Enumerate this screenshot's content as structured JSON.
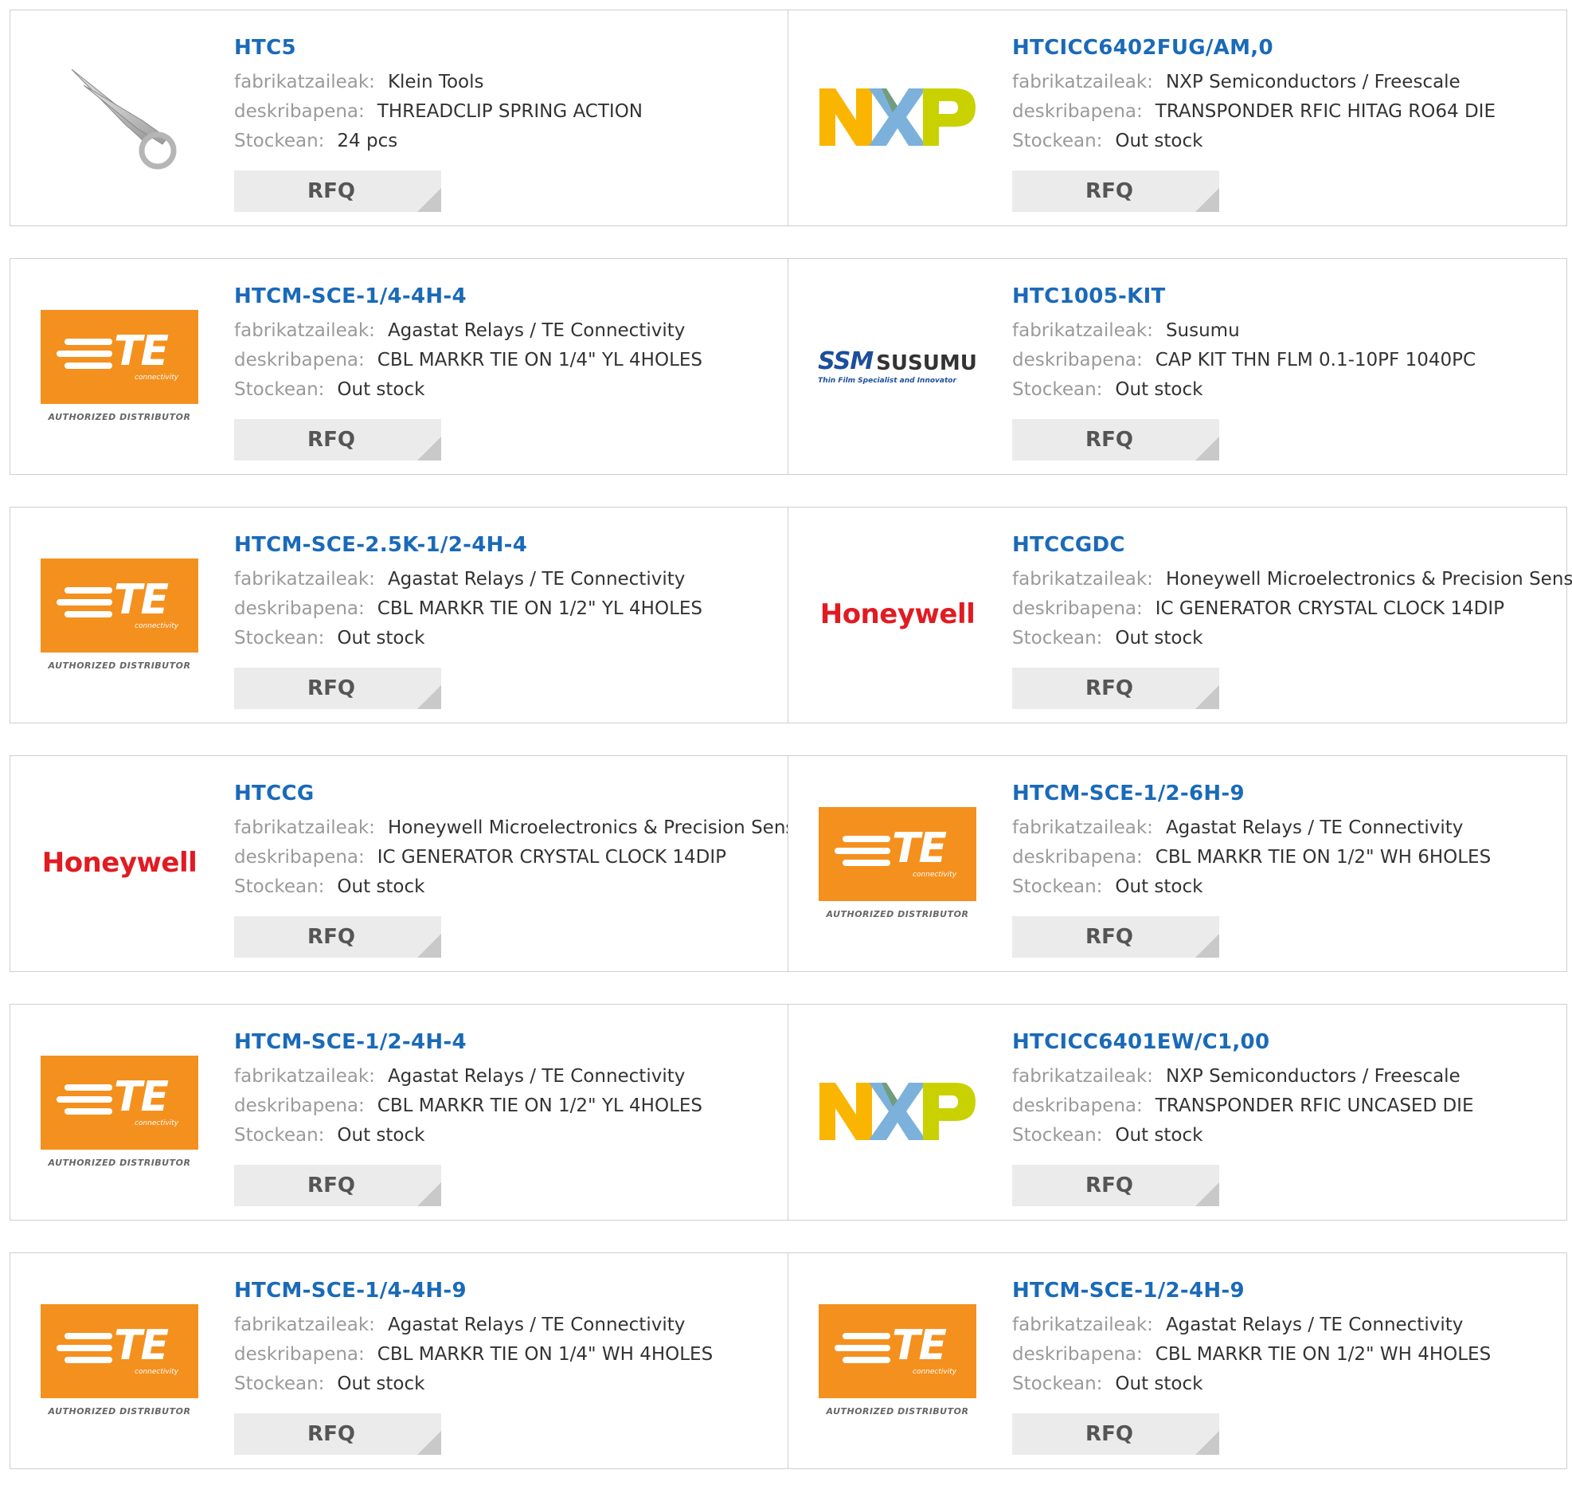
{
  "labels": {
    "manufacturer": "fabrikatzaileak:",
    "description": "deskribapena:",
    "stock": "Stockean:",
    "rfq": "RFQ"
  },
  "logo_texts": {
    "te_authorized": "AUTHORIZED DISTRIBUTOR",
    "te_sub": "connectivity",
    "te_letters": "TE",
    "honeywell": "Honeywell",
    "susumu_mark": "SSM",
    "susumu_name": "SUSUMU",
    "susumu_tag": "Thin Film Specialist and Innovator",
    "nxp": "NXP"
  },
  "colors": {
    "part_link": "#1a6ab8",
    "te_orange": "#f4901e",
    "honeywell_red": "#e11b22",
    "nxp_yellow": "#f9b500",
    "nxp_blue": "#7bb1db",
    "nxp_green": "#c9d200"
  },
  "products": [
    {
      "part": "HTC5",
      "logo": "scissors-image",
      "manufacturer": "Klein Tools",
      "description": "THREADCLIP SPRING ACTION",
      "stock": "24 pcs"
    },
    {
      "part": "HTCICC6402FUG/AM,0",
      "logo": "nxp",
      "manufacturer": "NXP Semiconductors / Freescale",
      "description": "TRANSPONDER RFIC HITAG RO64 DIE",
      "stock": "Out stock"
    },
    {
      "part": "HTCM-SCE-1/4-4H-4",
      "logo": "te",
      "manufacturer": "Agastat Relays / TE Connectivity",
      "description": "CBL MARKR TIE ON 1/4\" YL 4HOLES",
      "stock": "Out stock"
    },
    {
      "part": "HTC1005-KIT",
      "logo": "susumu",
      "manufacturer": "Susumu",
      "description": "CAP KIT THN FLM 0.1-10PF 1040PC",
      "stock": "Out stock"
    },
    {
      "part": "HTCM-SCE-2.5K-1/2-4H-4",
      "logo": "te",
      "manufacturer": "Agastat Relays / TE Connectivity",
      "description": "CBL MARKR TIE ON 1/2\" YL 4HOLES",
      "stock": "Out stock"
    },
    {
      "part": "HTCCGDC",
      "logo": "honeywell",
      "manufacturer": "Honeywell Microelectronics & Precision Sensors",
      "description": "IC GENERATOR CRYSTAL CLOCK 14DIP",
      "stock": "Out stock"
    },
    {
      "part": "HTCCG",
      "logo": "honeywell",
      "manufacturer": "Honeywell Microelectronics & Precision Sensors",
      "description": "IC GENERATOR CRYSTAL CLOCK 14DIP",
      "stock": "Out stock"
    },
    {
      "part": "HTCM-SCE-1/2-6H-9",
      "logo": "te",
      "manufacturer": "Agastat Relays / TE Connectivity",
      "description": "CBL MARKR TIE ON 1/2\" WH 6HOLES",
      "stock": "Out stock"
    },
    {
      "part": "HTCM-SCE-1/2-4H-4",
      "logo": "te",
      "manufacturer": "Agastat Relays / TE Connectivity",
      "description": "CBL MARKR TIE ON 1/2\" YL 4HOLES",
      "stock": "Out stock"
    },
    {
      "part": "HTCICC6401EW/C1,00",
      "logo": "nxp",
      "manufacturer": "NXP Semiconductors / Freescale",
      "description": "TRANSPONDER RFIC UNCASED DIE",
      "stock": "Out stock"
    },
    {
      "part": "HTCM-SCE-1/4-4H-9",
      "logo": "te",
      "manufacturer": "Agastat Relays / TE Connectivity",
      "description": "CBL MARKR TIE ON 1/4\" WH 4HOLES",
      "stock": "Out stock"
    },
    {
      "part": "HTCM-SCE-1/2-4H-9",
      "logo": "te",
      "manufacturer": "Agastat Relays / TE Connectivity",
      "description": "CBL MARKR TIE ON 1/2\" WH 4HOLES",
      "stock": "Out stock"
    }
  ]
}
